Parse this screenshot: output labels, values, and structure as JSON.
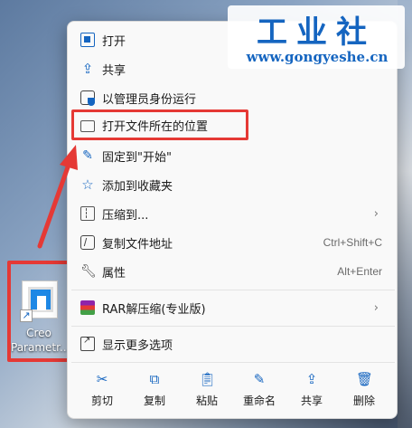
{
  "desktop_icon": {
    "label": "Creo\nParametr..."
  },
  "context_menu": {
    "items": [
      {
        "label": "打开",
        "icon": "open-icon"
      },
      {
        "label": "共享",
        "icon": "share-icon"
      },
      {
        "label": "以管理员身份运行",
        "icon": "admin-shield-icon"
      },
      {
        "label": "打开文件所在的位置",
        "icon": "folder-icon"
      },
      {
        "label": "固定到\"开始\"",
        "icon": "pin-icon"
      },
      {
        "label": "添加到收藏夹",
        "icon": "star-icon"
      },
      {
        "label": "压缩到...",
        "icon": "zip-folder-icon",
        "submenu": true
      },
      {
        "label": "复制文件地址",
        "icon": "copy-path-icon",
        "shortcut": "Ctrl+Shift+C"
      },
      {
        "label": "属性",
        "icon": "wrench-icon",
        "shortcut": "Alt+Enter"
      },
      {
        "label": "RAR解压缩(专业版)",
        "icon": "rar-icon",
        "submenu": true
      },
      {
        "label": "显示更多选项",
        "icon": "more-options-icon"
      }
    ],
    "submenu_glyph": "›",
    "toolbar": [
      {
        "label": "剪切",
        "icon": "cut-icon"
      },
      {
        "label": "复制",
        "icon": "copy-icon"
      },
      {
        "label": "粘贴",
        "icon": "paste-icon"
      },
      {
        "label": "重命名",
        "icon": "rename-icon"
      },
      {
        "label": "共享",
        "icon": "share-icon"
      },
      {
        "label": "删除",
        "icon": "delete-icon"
      }
    ]
  },
  "watermark": {
    "title": "工业社",
    "url": "www.gongyeshe.cn"
  },
  "colors": {
    "highlight": "#e53935",
    "accent": "#1565c0"
  }
}
